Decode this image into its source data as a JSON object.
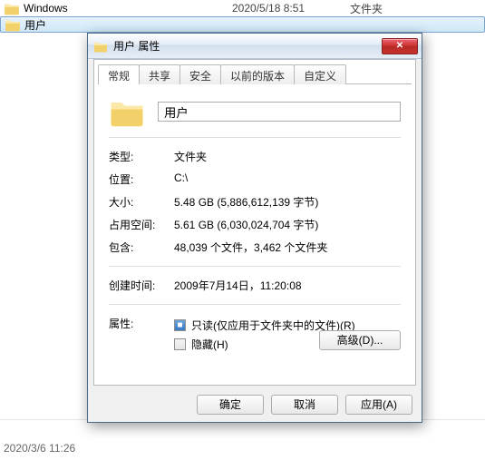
{
  "explorer": {
    "rows": [
      {
        "name": "Windows",
        "date": "2020/5/18 8:51",
        "type": "文件夹",
        "selected": false
      },
      {
        "name": "用户",
        "date": "",
        "type": "",
        "selected": true
      }
    ],
    "status": "2020/3/6 11:26"
  },
  "dialog": {
    "title": "用户 属性",
    "tabs": [
      "常规",
      "共享",
      "安全",
      "以前的版本",
      "自定义"
    ],
    "active_tab": 0,
    "folder_name": "用户",
    "fields": {
      "type_label": "类型:",
      "type_value": "文件夹",
      "location_label": "位置:",
      "location_value": "C:\\",
      "size_label": "大小:",
      "size_value": "5.48 GB (5,886,612,139 字节)",
      "ondisk_label": "占用空间:",
      "ondisk_value": "5.61 GB (6,030,024,704 字节)",
      "contains_label": "包含:",
      "contains_value": "48,039 个文件，3,462 个文件夹",
      "created_label": "创建时间:",
      "created_value": "2009年7月14日，11:20:08",
      "attr_label": "属性:",
      "readonly_label": "只读(仅应用于文件夹中的文件)(R)",
      "hidden_label": "隐藏(H)",
      "advanced_label": "高级(D)..."
    },
    "buttons": {
      "ok": "确定",
      "cancel": "取消",
      "apply": "应用(A)"
    }
  }
}
